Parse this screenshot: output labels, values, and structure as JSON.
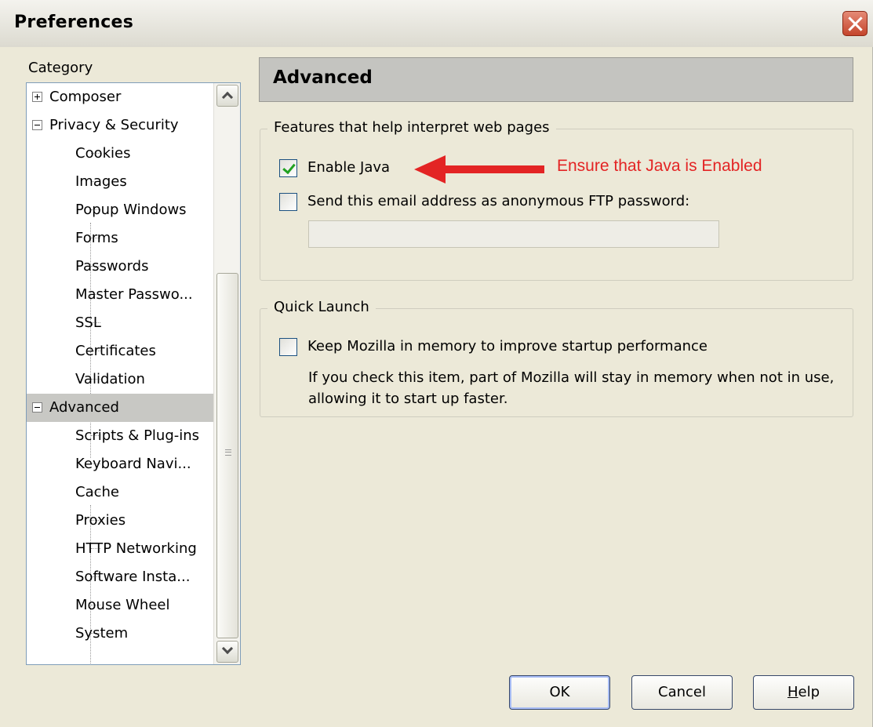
{
  "window": {
    "title": "Preferences"
  },
  "sidebar": {
    "category_label": "Category",
    "items": [
      {
        "label": "Composer",
        "expander": "plus",
        "level": 0,
        "selected": false
      },
      {
        "label": "Privacy & Security",
        "expander": "minus",
        "level": 0,
        "selected": false
      },
      {
        "label": "Cookies",
        "level": 1,
        "selected": false
      },
      {
        "label": "Images",
        "level": 1,
        "selected": false
      },
      {
        "label": "Popup Windows",
        "level": 1,
        "selected": false
      },
      {
        "label": "Forms",
        "level": 1,
        "selected": false
      },
      {
        "label": "Passwords",
        "level": 1,
        "selected": false
      },
      {
        "label": "Master Passwo...",
        "level": 1,
        "selected": false
      },
      {
        "label": "SSL",
        "level": 1,
        "selected": false
      },
      {
        "label": "Certificates",
        "level": 1,
        "selected": false
      },
      {
        "label": "Validation",
        "level": 1,
        "selected": false
      },
      {
        "label": "Advanced",
        "expander": "minus",
        "level": 0,
        "selected": true
      },
      {
        "label": "Scripts & Plug-ins",
        "level": 1,
        "selected": false
      },
      {
        "label": "Keyboard Navi...",
        "level": 1,
        "selected": false
      },
      {
        "label": "Cache",
        "level": 1,
        "selected": false
      },
      {
        "label": "Proxies",
        "level": 1,
        "selected": false
      },
      {
        "label": "HTTP Networking",
        "level": 1,
        "selected": false
      },
      {
        "label": "Software Insta...",
        "level": 1,
        "selected": false
      },
      {
        "label": "Mouse Wheel",
        "level": 1,
        "selected": false
      },
      {
        "label": "System",
        "level": 1,
        "selected": false
      }
    ]
  },
  "main": {
    "header_title": "Advanced",
    "features_group": {
      "legend": "Features that help interpret web pages",
      "enable_java_label": "Enable Java",
      "enable_java_checked": true,
      "ftp_password_label": "Send this email address as anonymous FTP password:",
      "ftp_password_checked": false,
      "ftp_email_value": ""
    },
    "quick_launch_group": {
      "legend": "Quick Launch",
      "keep_in_memory_label": "Keep Mozilla in memory to improve startup performance",
      "keep_in_memory_checked": false,
      "help_text": "If you check this item, part of Mozilla will stay in memory when not in use, allowing it to start up faster."
    }
  },
  "annotation": {
    "text": "Ensure that Java is Enabled",
    "color": "#e32424"
  },
  "buttons": {
    "ok": "OK",
    "cancel": "Cancel",
    "help": "Help"
  },
  "icons": {
    "close": "close-icon",
    "scroll_up": "chevron-up-icon",
    "scroll_down": "chevron-down-icon",
    "checkbox_check": "checkmark-icon",
    "annotation_arrow": "red-arrow-left-icon"
  }
}
